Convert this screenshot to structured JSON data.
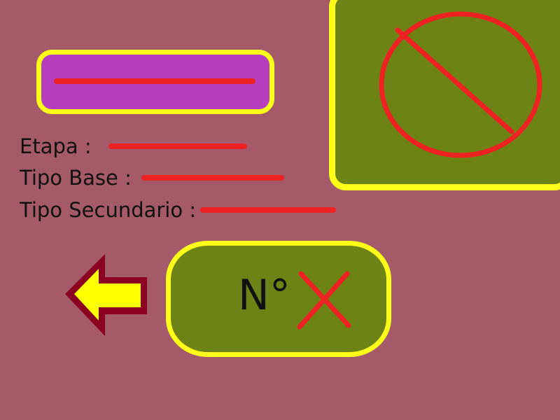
{
  "name_field": {
    "placeholder_color": "#ee2222",
    "fill_color": "#b53fbe",
    "border_color": "#ffff1a"
  },
  "image_panel": {
    "icon": "no-image-prohibited-icon",
    "fill_color": "#6d8316",
    "icon_color": "#ee2222"
  },
  "details": {
    "etapa_label": "Etapa :",
    "tipo_base_label": "Tipo Base :",
    "tipo_secundario_label": "Tipo Secundario :"
  },
  "back_button": {
    "icon": "arrow-left-icon",
    "fill_color": "#ffff00",
    "border_color": "#8b0020"
  },
  "number_badge": {
    "label": "N°",
    "empty_icon": "x-mark-icon"
  },
  "colors": {
    "background": "#a55a69",
    "accent_yellow": "#ffff1a",
    "placeholder_red": "#ee2222"
  }
}
